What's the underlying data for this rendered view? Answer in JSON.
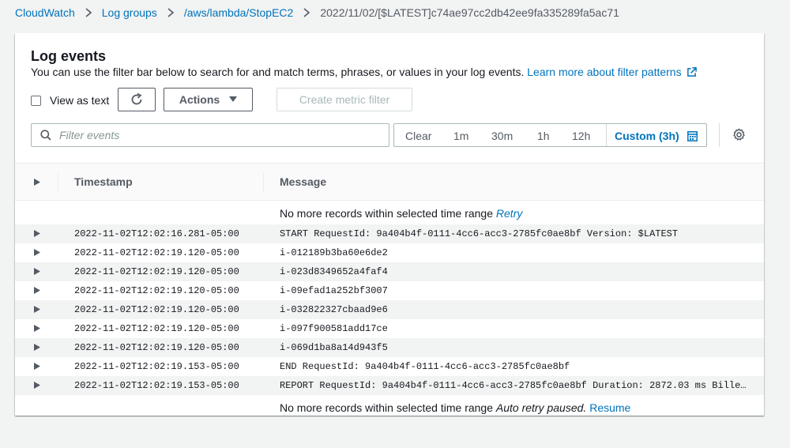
{
  "breadcrumb": {
    "items": [
      "CloudWatch",
      "Log groups",
      "/aws/lambda/StopEC2"
    ],
    "current": "2022/11/02/[$LATEST]c74ae97cc2db42ee9fa335289fa5ac71"
  },
  "panel": {
    "title": "Log events",
    "description": "You can use the filter bar below to search for and match terms, phrases, or values in your log events.",
    "learn_more": "Learn more about filter patterns"
  },
  "toolbar": {
    "view_as_text": "View as text",
    "view_as_text_checked": false,
    "actions_label": "Actions",
    "create_metric_filter": "Create metric filter"
  },
  "filter": {
    "placeholder": "Filter events",
    "value": ""
  },
  "time_range": {
    "clear": "Clear",
    "options": [
      "1m",
      "30m",
      "1h",
      "12h"
    ],
    "custom": "Custom (3h)"
  },
  "table": {
    "columns": [
      "Timestamp",
      "Message"
    ],
    "top_notice": {
      "text": "No more records within selected time range",
      "link": "Retry"
    },
    "rows": [
      {
        "timestamp": "2022-11-02T12:02:16.281-05:00",
        "message": "START RequestId: 9a404b4f-0111-4cc6-acc3-2785fc0ae8bf Version: $LATEST"
      },
      {
        "timestamp": "2022-11-02T12:02:19.120-05:00",
        "message": "i-012189b3ba60e6de2"
      },
      {
        "timestamp": "2022-11-02T12:02:19.120-05:00",
        "message": "i-023d8349652a4faf4"
      },
      {
        "timestamp": "2022-11-02T12:02:19.120-05:00",
        "message": "i-09efad1a252bf3007"
      },
      {
        "timestamp": "2022-11-02T12:02:19.120-05:00",
        "message": "i-032822327cbaad9e6"
      },
      {
        "timestamp": "2022-11-02T12:02:19.120-05:00",
        "message": "i-097f900581add17ce"
      },
      {
        "timestamp": "2022-11-02T12:02:19.120-05:00",
        "message": "i-069d1ba8a14d943f5"
      },
      {
        "timestamp": "2022-11-02T12:02:19.153-05:00",
        "message": "END RequestId: 9a404b4f-0111-4cc6-acc3-2785fc0ae8bf"
      },
      {
        "timestamp": "2022-11-02T12:02:19.153-05:00",
        "message": "REPORT RequestId: 9a404b4f-0111-4cc6-acc3-2785fc0ae8bf Duration: 2872.03 ms Billed …"
      }
    ],
    "bottom_notice": {
      "text": "No more records within selected time range",
      "paused": "Auto retry paused.",
      "link": "Resume"
    }
  },
  "colors": {
    "link": "#0073bb",
    "text": "#16191f",
    "muted": "#545b64",
    "background": "#f2f3f3"
  },
  "icons": [
    "chevron-right-icon",
    "external-link-icon",
    "refresh-icon",
    "caret-down-icon",
    "search-icon",
    "calendar-icon",
    "gear-icon",
    "expand-triangle-icon"
  ]
}
